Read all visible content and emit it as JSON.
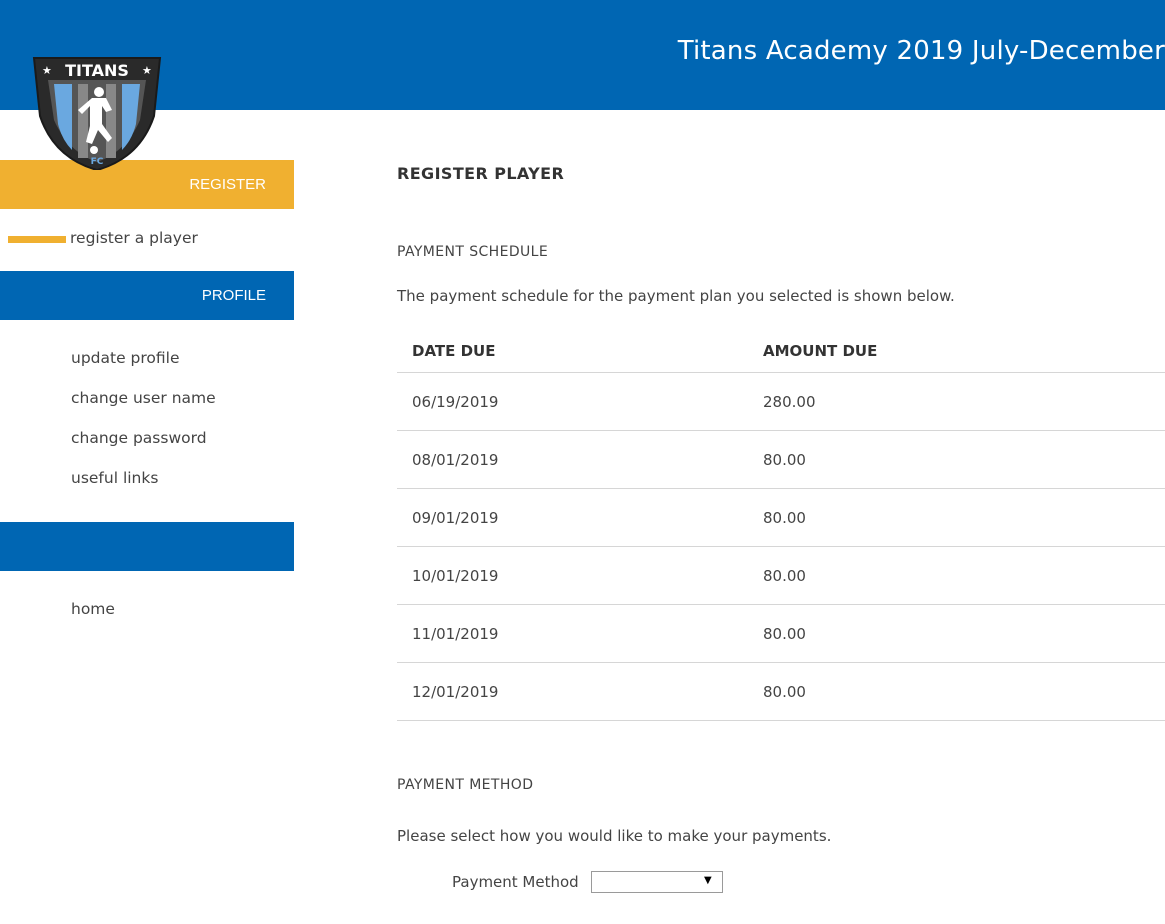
{
  "header": {
    "title": "Titans Academy 2019 July-December",
    "bg_color": "#0066b3"
  },
  "logo": {
    "text": "TITANS",
    "sub_text": "FC",
    "icon": "soccer-player-shield-icon"
  },
  "sidebar": {
    "register_header": "REGISTER",
    "register_items": [
      {
        "label": "register a player",
        "active": true
      }
    ],
    "profile_header": "PROFILE",
    "profile_items": [
      {
        "label": "update profile"
      },
      {
        "label": "change user name"
      },
      {
        "label": "change password"
      },
      {
        "label": "useful links"
      }
    ],
    "other_items": [
      {
        "label": "home"
      }
    ],
    "accent_gold": "#f0b030",
    "accent_blue": "#0066b3"
  },
  "main": {
    "page_title": "REGISTER PLAYER",
    "schedule_title": "PAYMENT SCHEDULE",
    "schedule_intro": "The payment schedule for the payment plan you selected is shown below.",
    "table": {
      "headers": [
        "DATE DUE",
        "AMOUNT DUE"
      ],
      "rows": [
        [
          "06/19/2019",
          "280.00"
        ],
        [
          "08/01/2019",
          "80.00"
        ],
        [
          "09/01/2019",
          "80.00"
        ],
        [
          "10/01/2019",
          "80.00"
        ],
        [
          "11/01/2019",
          "80.00"
        ],
        [
          "12/01/2019",
          "80.00"
        ]
      ]
    },
    "method_title": "PAYMENT METHOD",
    "method_intro": "Please select how you would like to make your payments.",
    "method_label": "Payment Method",
    "method_value": ""
  }
}
